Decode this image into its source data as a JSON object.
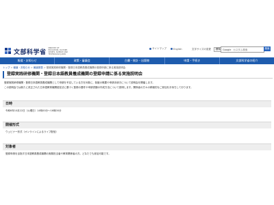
{
  "header": {
    "logo_text": "文部科学省",
    "logo_sub": "MINISTRY OF EDUCATION, CULTURE, SPORTS, SCIENCE AND TECHNOLOGY-JAPAN",
    "util_links": [
      "サイトマップ",
      "English"
    ],
    "font_size_label": "文字サイズの変更",
    "font_size_options": [
      "標準",
      "大"
    ],
    "search_brand": "Google",
    "search_placeholder": "カスタム検索",
    "search_button": "検索"
  },
  "nav": {
    "items": [
      "報道・お知らせ",
      "政策・審議会",
      "白書・統計・出版物",
      "申請・手続き",
      "文部科学省の紹介"
    ]
  },
  "breadcrumb": {
    "items": [
      "トップ",
      "報道・お知らせ",
      "報道発表",
      "登録実践研修機関・登録日本語教員養成機関の登録申請に係る実施説明会"
    ]
  },
  "main": {
    "title": "登録実践研修機関・登録日本語教員養成機関の登録申請に係る実施説明会",
    "intro_lines": [
      "登録実践研修機関・登録日本語教員養成機関として申請を予定している方を対象に、制度の概要や申請手続きについて説明会を開催します。",
      "この説明会では新たに改正された日本語教育機関認定法に基づく登録の要件や申請書類の作成方法について説明します。関係者の方々の積極的なご参加をお待ちしております。"
    ]
  },
  "sections": {
    "date_heading": "日時",
    "date_value": "令和6年10月22日（火曜日）14時00分～16時00分",
    "format_heading": "開催形式",
    "format_value": "ウェビナー形式（オンラインによるライブ配信）",
    "target_heading": "対象者",
    "target_value": "登録申請を目指す日本語教員養成機関の実務担当者や教育関係者の方。どなたでも参加可能です。"
  },
  "colors": {
    "nav_bg": "#1e5cae",
    "accent": "#1e5cae",
    "section_bg": "#eeeeee"
  }
}
